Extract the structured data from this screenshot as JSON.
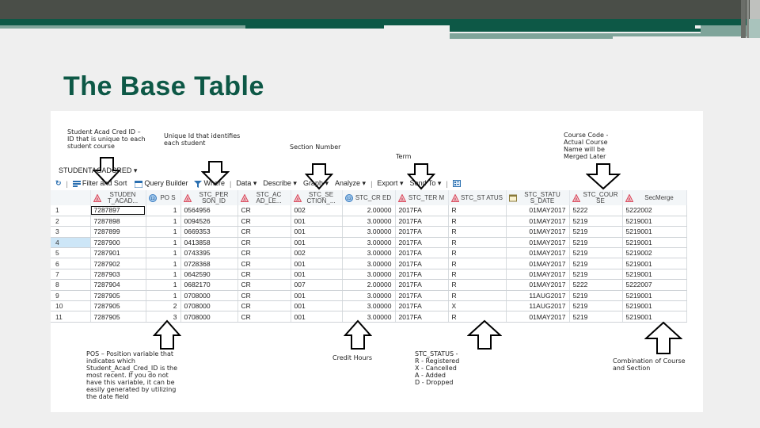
{
  "slide": {
    "title": "The Base Table",
    "accent_color": "#0d5846"
  },
  "annotations": {
    "student_acad_cred_id": "Student Acad Cred ID – ID that is unique to each student course",
    "unique_id": "Unique Id that identifies each student",
    "section_number": "Section Number",
    "term": "Term",
    "course_code": "Course Code - Actual Course Name will be Merged Later",
    "pos": "POS – Position variable that indicates which Student_Acad_Cred_ID is the most recent. If you do not have this variable, it can be easily generated by utilizing the date field",
    "credit_hours": "Credit Hours",
    "stc_status_title": "STC_STATUS -",
    "stc_status_lines": [
      "R - Registered",
      "X - Cancelled",
      "A - Added",
      "D - Dropped"
    ],
    "secmerge": "Combination of Course and Section"
  },
  "dataset": {
    "name": "STUDENTACADCRED"
  },
  "toolbar": {
    "filter_sort": "Filter and Sort",
    "query_builder": "Query Builder",
    "where": "Where",
    "data": "Data",
    "describe": "Describe",
    "graph": "Graph",
    "analyze": "Analyze",
    "export": "Export",
    "send_to": "Send To"
  },
  "table": {
    "columns": [
      {
        "label": "STUDEN T_ACAD...",
        "icon": "character-icon"
      },
      {
        "label": "PO S",
        "icon": "numeric-icon"
      },
      {
        "label": "STC_PER SON_ID",
        "icon": "character-icon"
      },
      {
        "label": "STC_AC AD_LE...",
        "icon": "character-icon"
      },
      {
        "label": "STC_SE CTION_...",
        "icon": "character-icon"
      },
      {
        "label": "STC_CR ED",
        "icon": "numeric-icon"
      },
      {
        "label": "STC_TER M",
        "icon": "character-icon"
      },
      {
        "label": "STC_ST ATUS",
        "icon": "character-icon"
      },
      {
        "label": "STC_STATU S_DATE",
        "icon": "date-icon"
      },
      {
        "label": "STC_COUR SE",
        "icon": "character-icon"
      },
      {
        "label": "SecMerge",
        "icon": "character-icon"
      }
    ],
    "rows": [
      [
        "1",
        "7287897",
        "1",
        "0564956",
        "CR",
        "002",
        "2.00000",
        "2017FA",
        "R",
        "01MAY2017",
        "5222",
        "5222002"
      ],
      [
        "2",
        "7287898",
        "1",
        "0094526",
        "CR",
        "001",
        "3.00000",
        "2017FA",
        "R",
        "01MAY2017",
        "5219",
        "5219001"
      ],
      [
        "3",
        "7287899",
        "1",
        "0669353",
        "CR",
        "001",
        "3.00000",
        "2017FA",
        "R",
        "01MAY2017",
        "5219",
        "5219001"
      ],
      [
        "4",
        "7287900",
        "1",
        "0413858",
        "CR",
        "001",
        "3.00000",
        "2017FA",
        "R",
        "01MAY2017",
        "5219",
        "5219001"
      ],
      [
        "5",
        "7287901",
        "1",
        "0743395",
        "CR",
        "002",
        "3.00000",
        "2017FA",
        "R",
        "01MAY2017",
        "5219",
        "5219002"
      ],
      [
        "6",
        "7287902",
        "1",
        "0728368",
        "CR",
        "001",
        "3.00000",
        "2017FA",
        "R",
        "01MAY2017",
        "5219",
        "5219001"
      ],
      [
        "7",
        "7287903",
        "1",
        "0642590",
        "CR",
        "001",
        "3.00000",
        "2017FA",
        "R",
        "01MAY2017",
        "5219",
        "5219001"
      ],
      [
        "8",
        "7287904",
        "1",
        "0682170",
        "CR",
        "007",
        "2.00000",
        "2017FA",
        "R",
        "01MAY2017",
        "5222",
        "5222007"
      ],
      [
        "9",
        "7287905",
        "1",
        "0708000",
        "CR",
        "001",
        "3.00000",
        "2017FA",
        "R",
        "11AUG2017",
        "5219",
        "5219001"
      ],
      [
        "10",
        "7287905",
        "2",
        "0708000",
        "CR",
        "001",
        "3.00000",
        "2017FA",
        "X",
        "11AUG2017",
        "5219",
        "5219001"
      ],
      [
        "11",
        "7287905",
        "3",
        "0708000",
        "CR",
        "001",
        "3.00000",
        "2017FA",
        "R",
        "01MAY2017",
        "5219",
        "5219001"
      ]
    ],
    "selected_row": 4,
    "focused_cell": "1,STUDENT_ACAD"
  }
}
